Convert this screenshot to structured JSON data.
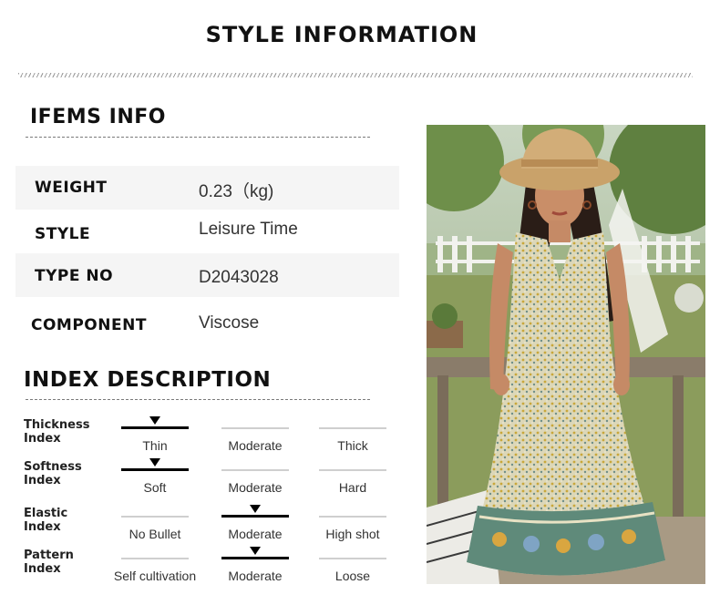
{
  "header": {
    "title": "STYLE INFORMATION"
  },
  "items_info": {
    "title": "IFEMS INFO",
    "rows": [
      {
        "key": "WEIGHT",
        "value": "0.23（kg)"
      },
      {
        "key": "STYLE",
        "value": "Leisure Time"
      },
      {
        "key": "TYPE NO",
        "value": "D2043028"
      },
      {
        "key": "COMPONENT",
        "value": "Viscose"
      }
    ]
  },
  "index_description": {
    "title": "INDEX DESCRIPTION",
    "indexes": [
      {
        "label_line1": "Thickness",
        "label_line2": "Index",
        "options": [
          "Thin",
          "Moderate",
          "Thick"
        ],
        "selected": 0
      },
      {
        "label_line1": "Softness",
        "label_line2": "Index",
        "options": [
          "Soft",
          "Moderate",
          "Hard"
        ],
        "selected": 0
      },
      {
        "label_line1": "Elastic",
        "label_line2": "Index",
        "options": [
          "No Bullet",
          "Moderate",
          "High shot"
        ],
        "selected": 1
      },
      {
        "label_line1": "Pattern",
        "label_line2": "Index",
        "options": [
          "Self cultivation",
          "Moderate",
          "Loose"
        ],
        "selected": 1
      }
    ]
  },
  "colors": {
    "text": "#111111",
    "shade": "#f5f5f5",
    "selected": "#000000",
    "unselected": "#d0d0d0"
  }
}
